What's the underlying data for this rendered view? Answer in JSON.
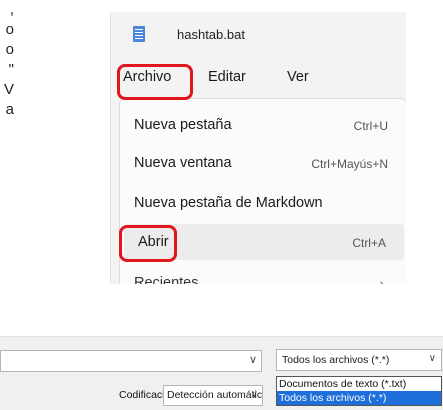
{
  "left_text": [
    ",",
    "o",
    "o",
    "\"",
    "V",
    "a"
  ],
  "window": {
    "title": "hashtab.bat",
    "icon": "notepad-file-icon"
  },
  "menubar": {
    "items": [
      "Archivo",
      "Editar",
      "Ver"
    ]
  },
  "file_menu": {
    "items": [
      {
        "label": "Nueva pestaña",
        "shortcut": "Ctrl+U"
      },
      {
        "label": "Nueva ventana",
        "shortcut": "Ctrl+Mayús+N"
      },
      {
        "label": "Nueva pestaña de Markdown",
        "shortcut": ""
      },
      {
        "label": "Abrir",
        "shortcut": "Ctrl+A"
      },
      {
        "label": "Recientes",
        "shortcut": ""
      }
    ]
  },
  "dialog": {
    "encoding_label": "Codificación:",
    "encoding_value": "Detección automática",
    "file_type_value": "Todos los archivos  (*.*)",
    "file_type_options": [
      "Documentos de texto (*.txt)",
      "Todos los archivos  (*.*)"
    ]
  },
  "colors": {
    "highlight_red": "#e0161c",
    "selected_option": "#1e6fd9"
  }
}
